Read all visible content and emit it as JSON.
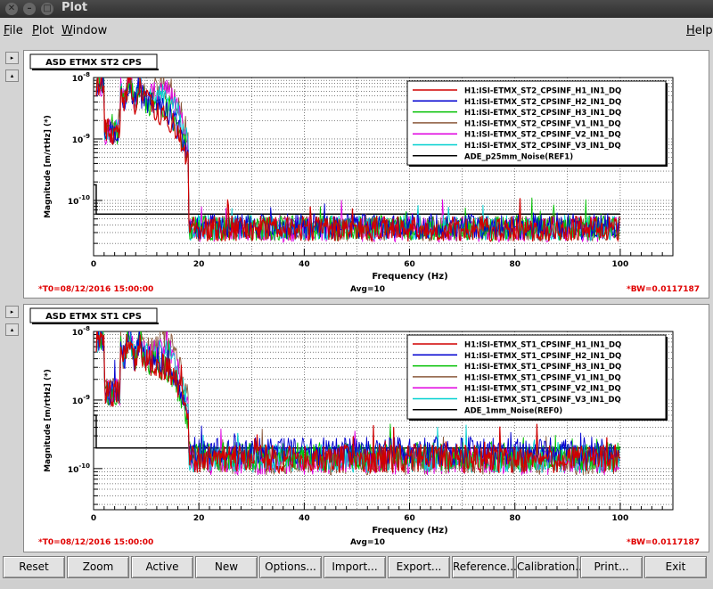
{
  "window": {
    "title": "Plot"
  },
  "menu": {
    "file": "File",
    "plot": "Plot",
    "window": "Window",
    "help": "Help"
  },
  "side_buttons": {
    "expand": "▸",
    "collapse": "▴"
  },
  "plots": [
    {
      "panel_title": "ASD ETMX ST2 CPS",
      "ylabel": "Magnitude [m/rtHz] (*)",
      "xlabel": "Frequency (Hz)",
      "footer_left": "*T0=08/12/2016 15:00:00",
      "footer_center": "Avg=10",
      "footer_right": "*BW=0.0117187",
      "colors": {
        "legend_black": "#000000"
      },
      "chart_data": {
        "type": "line",
        "title": "ASD ETMX ST2 CPS",
        "xlabel": "Frequency (Hz)",
        "ylabel": "Magnitude [m/rtHz] (*)",
        "xlim": [
          0,
          110
        ],
        "ylim_log10": [
          -10.9,
          -8
        ],
        "xscale": "linear",
        "yscale": "log",
        "grid": true,
        "legend_position": "top-right",
        "x_ticks": [
          0,
          20,
          40,
          60,
          80,
          100
        ],
        "y_ticks": [
          {
            "label": "10",
            "exp": "-8",
            "v": -8
          },
          {
            "label": "10",
            "exp": "-9",
            "v": -9
          },
          {
            "label": "10",
            "exp": "-10",
            "v": -10
          }
        ],
        "series": [
          {
            "name": "H1:ISI-ETMX_ST2_CPSINF_H1_IN1_DQ",
            "color": "#d00000",
            "noise_floor": 3.5e-11,
            "hump": 0.2
          },
          {
            "name": "H1:ISI-ETMX_ST2_CPSINF_H2_IN1_DQ",
            "color": "#0000d0",
            "noise_floor": 3.8e-11,
            "hump": 0.3
          },
          {
            "name": "H1:ISI-ETMX_ST2_CPSINF_H3_IN1_DQ",
            "color": "#00c000",
            "noise_floor": 3.6e-11,
            "hump": 0.3
          },
          {
            "name": "H1:ISI-ETMX_ST2_CPSINF_V1_IN1_DQ",
            "color": "#8b5a3c",
            "noise_floor": 3.5e-11,
            "hump": 1
          },
          {
            "name": "H1:ISI-ETMX_ST2_CPSINF_V2_IN1_DQ",
            "color": "#e000e0",
            "noise_floor": 3.4e-11,
            "hump": 0.8
          },
          {
            "name": "H1:ISI-ETMX_ST2_CPSINF_V3_IN1_DQ",
            "color": "#00d0d0",
            "noise_floor": 3.6e-11,
            "hump": 0.6
          },
          {
            "name": "ADE_p25mm_Noise(REF1)",
            "color": "#000000",
            "reference_level": 6e-11
          }
        ]
      }
    },
    {
      "panel_title": "ASD ETMX ST1 CPS",
      "ylabel": "Magnitude [m/rtHz] (*)",
      "xlabel": "Frequency (Hz)",
      "footer_left": "*T0=08/12/2016 15:00:00",
      "footer_center": "Avg=10",
      "footer_right": "*BW=0.0117187",
      "colors": {
        "legend_black": "#000000"
      },
      "chart_data": {
        "type": "line",
        "title": "ASD ETMX ST1 CPS",
        "xlabel": "Frequency (Hz)",
        "ylabel": "Magnitude [m/rtHz] (*)",
        "xlim": [
          0,
          110
        ],
        "ylim_log10": [
          -10.6,
          -8
        ],
        "xscale": "linear",
        "yscale": "log",
        "grid": true,
        "legend_position": "top-right",
        "x_ticks": [
          0,
          20,
          40,
          60,
          80,
          100
        ],
        "y_ticks": [
          {
            "label": "10",
            "exp": "-8",
            "v": -8
          },
          {
            "label": "10",
            "exp": "-9",
            "v": -9
          },
          {
            "label": "10",
            "exp": "-10",
            "v": -10
          }
        ],
        "series": [
          {
            "name": "H1:ISI-ETMX_ST1_CPSINF_H1_IN1_DQ",
            "color": "#d00000",
            "noise_floor": 1.4e-10,
            "hump": 0.3
          },
          {
            "name": "H1:ISI-ETMX_ST1_CPSINF_H2_IN1_DQ",
            "color": "#0000d0",
            "noise_floor": 1.8e-10,
            "hump": 0.4
          },
          {
            "name": "H1:ISI-ETMX_ST1_CPSINF_H3_IN1_DQ",
            "color": "#00c000",
            "noise_floor": 1.5e-10,
            "hump": 0.3
          },
          {
            "name": "H1:ISI-ETMX_ST1_CPSINF_V1_IN1_DQ",
            "color": "#8b5a3c",
            "noise_floor": 1.3e-10,
            "hump": 1
          },
          {
            "name": "H1:ISI-ETMX_ST1_CPSINF_V2_IN1_DQ",
            "color": "#e000e0",
            "noise_floor": 1.3e-10,
            "hump": 0.7
          },
          {
            "name": "H1:ISI-ETMX_ST1_CPSINF_V3_IN1_DQ",
            "color": "#00d0d0",
            "noise_floor": 1.4e-10,
            "hump": 0.6
          },
          {
            "name": "ADE_1mm_Noise(REF0)",
            "color": "#000000",
            "reference_level": 2e-10
          }
        ]
      }
    }
  ],
  "buttons": [
    "Reset",
    "Zoom",
    "Active",
    "New",
    "Options...",
    "Import...",
    "Export...",
    "Reference...",
    "Calibration...",
    "Print...",
    "Exit"
  ]
}
